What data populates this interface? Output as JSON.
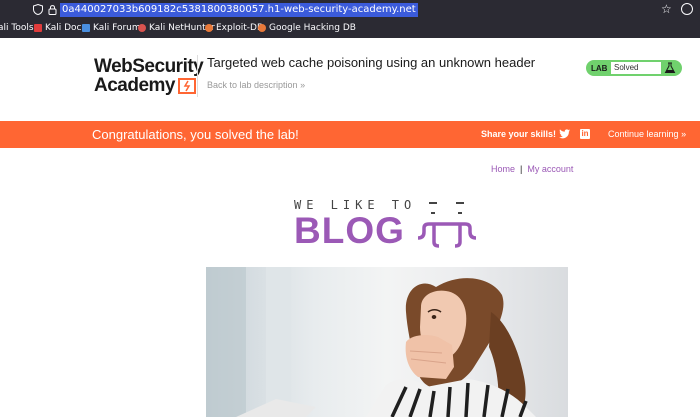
{
  "browser": {
    "url": "0a440027033b609182c5381800380057.h1-web-security-academy.net",
    "bookmarks": [
      {
        "label": "ali Tools",
        "icon": "kali-icon"
      },
      {
        "label": "Kali Docs",
        "icon": "kali-docs-icon"
      },
      {
        "label": "Kali Forums",
        "icon": "kali-forums-icon"
      },
      {
        "label": "Kali NetHunter",
        "icon": "nethunter-icon"
      },
      {
        "label": "Exploit-DB",
        "icon": "exploit-db-icon"
      },
      {
        "label": "Google Hacking DB",
        "icon": "ghdb-icon"
      }
    ]
  },
  "lab": {
    "logo_line1": "WebSecurity",
    "logo_line2": "Academy",
    "title": "Targeted web cache poisoning using an unknown header",
    "back_link": "Back to lab description",
    "back_chevron": "»",
    "status_label": "LAB",
    "status_value": "Solved"
  },
  "congrats": {
    "message": "Congratulations, you solved the lab!",
    "share": "Share your skills!",
    "linkedin_glyph": "in",
    "continue": "Continue learning",
    "continue_chevron": "»"
  },
  "nav": {
    "home": "Home",
    "separator": "|",
    "account": "My account"
  },
  "blog": {
    "tagline": "WE LIKE TO",
    "word": "BLOG"
  },
  "colors": {
    "accent_orange": "#ff6633",
    "solved_green": "#70d16d",
    "purple": "#9b59b6",
    "url_highlight": "#3b5bdb"
  }
}
